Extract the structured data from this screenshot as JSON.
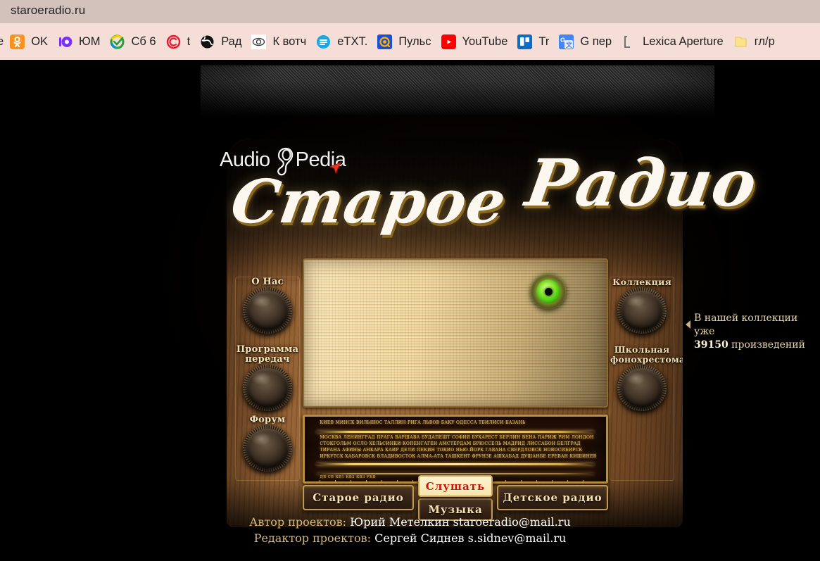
{
  "browser": {
    "tab_title": "staroeradio.ru",
    "bookmarks": [
      {
        "label": "e",
        "icon": "clipped-text-icon",
        "glyph": "",
        "style": "clip"
      },
      {
        "label": "OK",
        "icon": "odnoklassniki-icon",
        "glyph": "ok",
        "style": "ico-ok"
      },
      {
        "label": "ЮМ",
        "icon": "yum-icon",
        "glyph": "ю",
        "style": "ico-yum"
      },
      {
        "label": "Сб 6",
        "icon": "sberbank-icon",
        "glyph": "s",
        "style": "ico-sb"
      },
      {
        "label": "t",
        "icon": "copyright-icon",
        "glyph": "c",
        "style": "ico-c"
      },
      {
        "label": "Рад",
        "icon": "globe-icon",
        "glyph": "g",
        "style": "ico-rad"
      },
      {
        "label": "К вотч",
        "icon": "eye-icon",
        "glyph": "e",
        "style": "ico-watch"
      },
      {
        "label": "eTXT.",
        "icon": "etxt-icon",
        "glyph": "t",
        "style": "ico-etxt"
      },
      {
        "label": "Пульс",
        "icon": "puls-icon",
        "glyph": "@",
        "style": "ico-puls"
      },
      {
        "label": "YouTube",
        "icon": "youtube-icon",
        "glyph": "p",
        "style": "ico-yt"
      },
      {
        "label": "Tr",
        "icon": "trello-icon",
        "glyph": "tr",
        "style": "ico-tr"
      },
      {
        "label": "G пер",
        "icon": "google-translate-icon",
        "glyph": "gx",
        "style": "ico-gp"
      },
      {
        "label": "Lexica Aperture",
        "icon": "bracket-icon",
        "glyph": "l",
        "style": "ico-lex"
      },
      {
        "label": "гл/р",
        "icon": "folder-icon",
        "glyph": "f",
        "style": "ico-fold"
      }
    ]
  },
  "page": {
    "logo": {
      "word_left": "Audio",
      "word_right": "Pedia",
      "ear_icon": "ear-icon",
      "cursor_icon": "red-arrow-cursor-icon"
    },
    "title": {
      "word1": "Старое",
      "word2": "Радио"
    },
    "knobs_left": [
      {
        "label": "О  Нас",
        "name": "knob-about"
      },
      {
        "label": "Программа\nпередач",
        "line1": "Программа",
        "line2": "передач",
        "name": "knob-schedule"
      },
      {
        "label": "Форум",
        "name": "knob-forum"
      }
    ],
    "knobs_right": [
      {
        "line1": "Коллекция",
        "line2": "",
        "name": "knob-collection"
      },
      {
        "line1": "Школьная",
        "line2": "фонохрестоматия",
        "name": "knob-school-anthology"
      }
    ],
    "buttons": {
      "listen": "Слушать",
      "old_radio": "Старое  радио",
      "music": "Музыка",
      "kids_radio": "Детское  радио"
    },
    "indicator": {
      "name": "magic-eye-indicator",
      "color": "#6ee020"
    },
    "dial": {
      "cities_top": "КИЕВ  МИНСК  ВИЛЬНЮС  ТАЛЛИН  РИГА  ЛЬВОВ  БАКУ  ОДЕССА  ТБИЛИСИ  КАЗАНЬ",
      "cities_mid": "МОСКВА ЛЕНИНГРАД ПРАГА ВАРШАВА БУДАПЕШТ СОФИЯ БУХАРЕСТ БЕРЛИН ВЕНА ПАРИЖ РИМ ЛОНДОН СТОКГОЛЬМ ОСЛО ХЕЛЬСИНКИ КОПЕНГАГЕН АМСТЕРДАМ БРЮССЕЛЬ МАДРИД ЛИССАБОН БЕЛГРАД ТИРАНА АФИНЫ АНКАРА КАИР ДЕЛИ ПЕКИН ТОКИО НЬЮ-ЙОРК ГАВАНА СВЕРДЛОВСК НОВОСИБИРСК ИРКУТСК ХАБАРОВСК ВЛАДИВОСТОК АЛМА-АТА ТАШКЕНТ ФРУНЗЕ АШХАБАД ДУШАНБЕ ЕРЕВАН КИШИНЕВ",
      "cities_bot": "ДВ   СВ   КВ1   КВ2   КВ3   УКВ"
    },
    "collection": {
      "line1": "В нашей коллекции уже",
      "count": "39150",
      "line2_suffix": " произведений"
    },
    "credits": {
      "author_label": "Автор проектов:",
      "author_value": "Юрий Метелкин staroeradio@mail.ru",
      "editor_label": "Редактор проектов:",
      "editor_value": "Сергей Сиднев s.sidnev@mail.ru"
    }
  }
}
